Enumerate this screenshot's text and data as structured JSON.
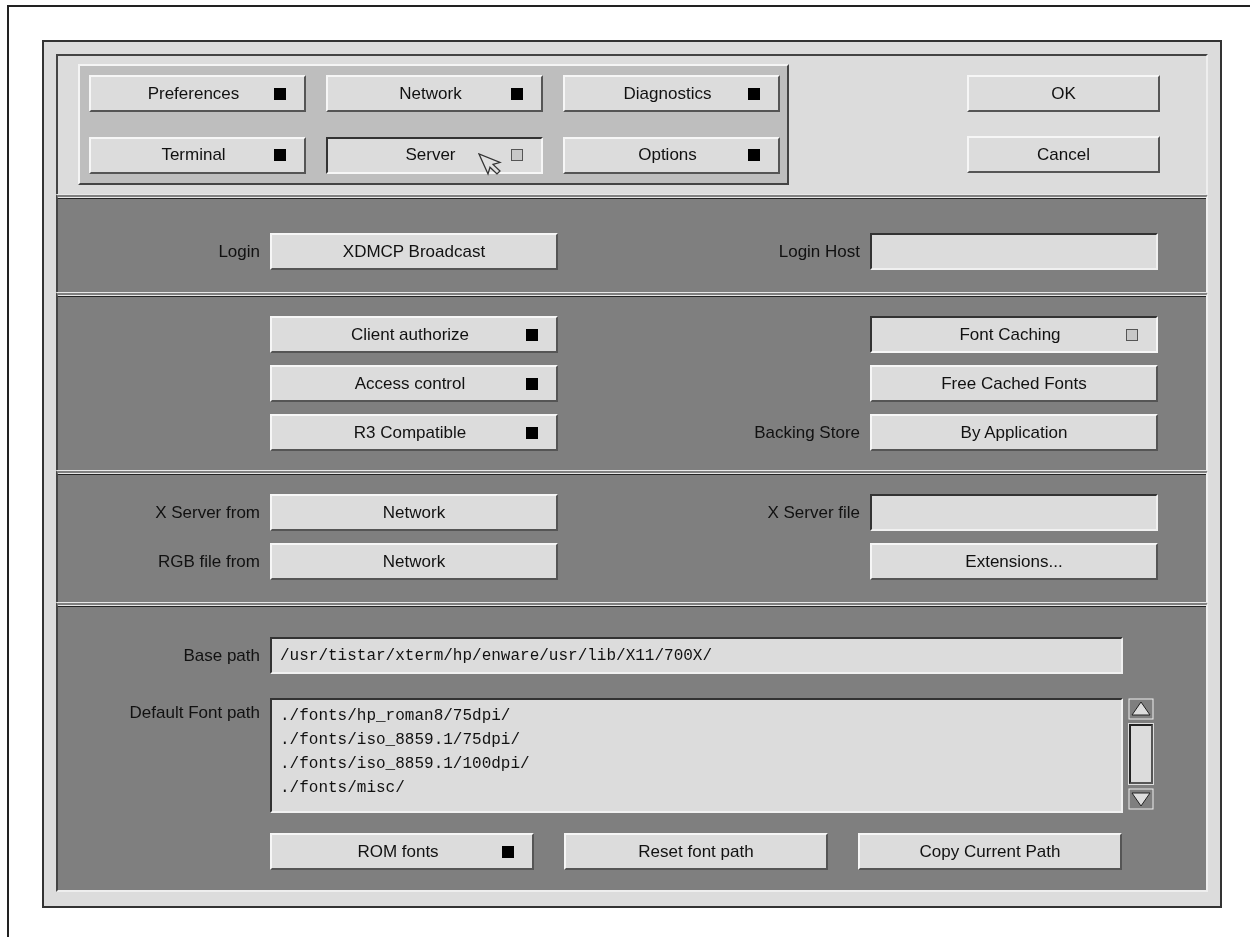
{
  "tabs": [
    {
      "label": "Preferences",
      "selected": false
    },
    {
      "label": "Network",
      "selected": false
    },
    {
      "label": "Diagnostics",
      "selected": false
    },
    {
      "label": "Terminal",
      "selected": false
    },
    {
      "label": "Server",
      "selected": true
    },
    {
      "label": "Options",
      "selected": false
    }
  ],
  "dialog_buttons": [
    "OK",
    "Cancel"
  ],
  "login": {
    "label": "Login",
    "button": "XDMCP Broadcast",
    "host_label": "Login Host"
  },
  "security_toggles": [
    {
      "label": "Client authorize",
      "on": false
    },
    {
      "label": "Access control",
      "on": false
    },
    {
      "label": "R3 Compatible",
      "on": false
    }
  ],
  "font_caching": {
    "label": "Font Caching",
    "on": true
  },
  "free_cached_fonts": "Free Cached Fonts",
  "backing_store": {
    "label": "Backing Store",
    "value": "By Application"
  },
  "x_server_from": {
    "label": "X Server from",
    "value": "Network"
  },
  "rgb_file_from": {
    "label": "RGB file from",
    "value": "Network"
  },
  "x_server_file": {
    "label": "X Server file"
  },
  "extensions": "Extensions...",
  "base_path": {
    "label": "Base path",
    "value": "/usr/tistar/xterm/hp/enware/usr/lib/X11/700X/"
  },
  "font_path": {
    "label": "Default Font path",
    "lines": [
      "./fonts/hp_roman8/75dpi/",
      "./fonts/iso_8859.1/75dpi/",
      "./fonts/iso_8859.1/100dpi/",
      "./fonts/misc/"
    ]
  },
  "rom_fonts": {
    "label": "ROM fonts",
    "on": false
  },
  "font_path_buttons": [
    "Reset font path",
    "Copy Current Path"
  ]
}
